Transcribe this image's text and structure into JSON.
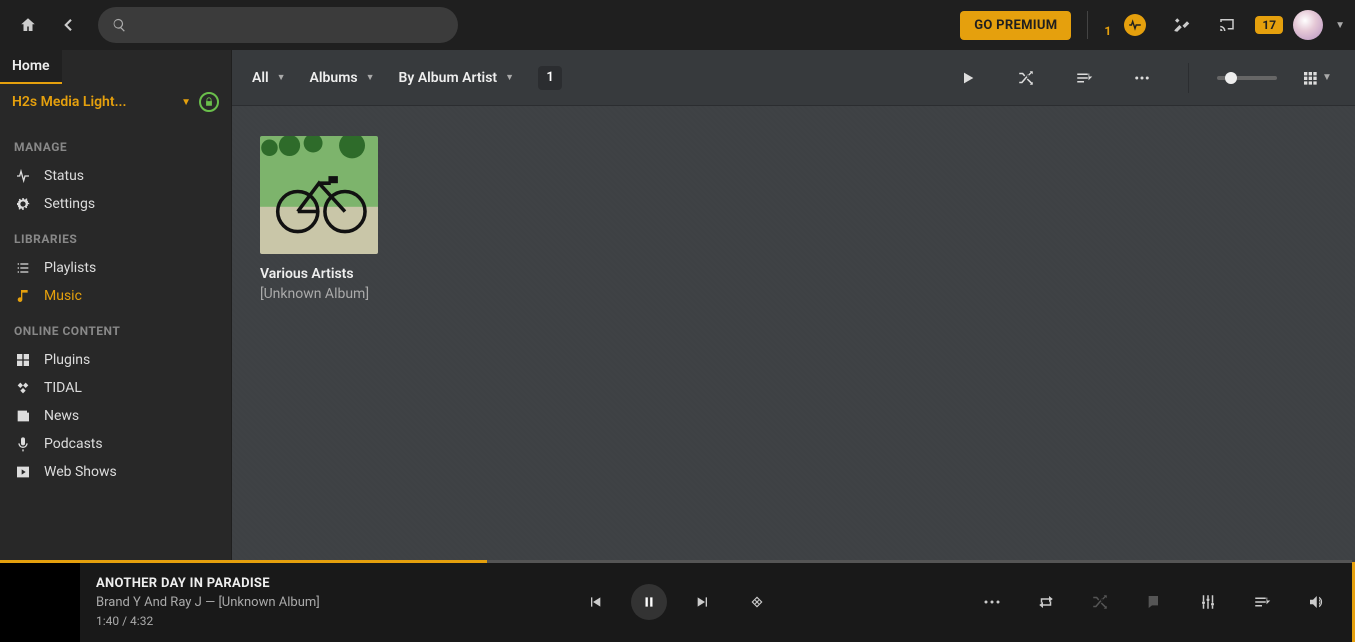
{
  "colors": {
    "accent": "#e5a00d",
    "bg_main": "#3f4245",
    "bg_dark": "#1f1f1f"
  },
  "topbar": {
    "premium_label": "GO PREMIUM",
    "activity_count": "1",
    "notification_count": "17"
  },
  "search": {
    "placeholder": ""
  },
  "home_tab": "Home",
  "server": {
    "name": "H2s Media Light..."
  },
  "sidebar": {
    "sections": [
      {
        "title": "MANAGE",
        "items": [
          {
            "icon": "pulse",
            "label": "Status"
          },
          {
            "icon": "gear",
            "label": "Settings"
          }
        ]
      },
      {
        "title": "LIBRARIES",
        "items": [
          {
            "icon": "list",
            "label": "Playlists"
          },
          {
            "icon": "music",
            "label": "Music",
            "active": true
          }
        ]
      },
      {
        "title": "ONLINE CONTENT",
        "items": [
          {
            "icon": "grid",
            "label": "Plugins"
          },
          {
            "icon": "tidal",
            "label": "TIDAL"
          },
          {
            "icon": "news",
            "label": "News"
          },
          {
            "icon": "mic",
            "label": "Podcasts"
          },
          {
            "icon": "play-rect",
            "label": "Web Shows"
          }
        ]
      }
    ]
  },
  "toolbar": {
    "filters": [
      {
        "label": "All"
      },
      {
        "label": "Albums"
      },
      {
        "label": "By Album Artist"
      }
    ],
    "result_count": "1"
  },
  "albums": [
    {
      "artist": "Various Artists",
      "album": "[Unknown Album]"
    }
  ],
  "player": {
    "title": "ANOTHER DAY IN PARADISE",
    "artist": "Brand Y And Ray J",
    "sep": " — ",
    "album": "[Unknown Album]",
    "elapsed": "1:40",
    "time_sep": " / ",
    "duration": "4:32",
    "progress_pct": 36
  }
}
